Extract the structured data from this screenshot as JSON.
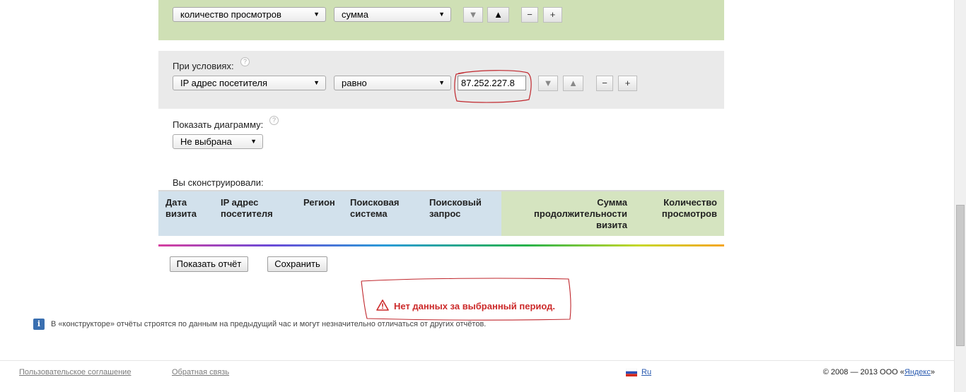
{
  "measure": {
    "metric_select": "количество просмотров",
    "aggregate_select": "сумма",
    "move_down": "▼",
    "move_up": "▲",
    "remove": "−",
    "add": "+"
  },
  "conditions": {
    "label": "При условиях:",
    "help": "?",
    "field_select": "IP адрес посетителя",
    "operator_select": "равно",
    "value": "87.252.227.8",
    "move_down": "▼",
    "move_up": "▲",
    "remove": "−",
    "add": "+"
  },
  "diagram": {
    "label": "Показать диаграмму:",
    "help": "?",
    "select": "Не выбрана"
  },
  "constructed": {
    "label": "Вы сконструировали:",
    "columns": [
      {
        "line1": "Дата",
        "line2": "визита",
        "line3": ""
      },
      {
        "line1": "IP адрес",
        "line2": "посетителя",
        "line3": ""
      },
      {
        "line1": "Регион",
        "line2": "",
        "line3": ""
      },
      {
        "line1": "Поисковая",
        "line2": "система",
        "line3": ""
      },
      {
        "line1": "Поисковый",
        "line2": "запрос",
        "line3": ""
      },
      {
        "line1": "Сумма",
        "line2": "продолжительности",
        "line3": "визита"
      },
      {
        "line1": "Количество",
        "line2": "просмотров",
        "line3": ""
      }
    ]
  },
  "actions": {
    "show_report": "Показать отчёт",
    "save": "Сохранить"
  },
  "error": {
    "message": "Нет данных за выбранный период."
  },
  "info": {
    "icon": "i",
    "text": "В «конструкторе» отчёты строятся по данным на предыдущий час и могут незначительно отличаться от других отчётов."
  },
  "footer": {
    "agreement": "Пользовательское соглашение",
    "feedback": "Обратная связь",
    "language": "Ru",
    "copyright_prefix": "© 2008 — 2013 ООО «",
    "company": "Яндекс",
    "copyright_suffix": "»"
  },
  "colors": {
    "measure_bg": "#cfe0b5",
    "conditions_bg": "#eaeaea",
    "dim_header_bg": "#d2e1ec",
    "metric_header_bg": "#d5e4c0",
    "error_red": "#cc2a2a",
    "annotation_red": "#c0272d"
  },
  "icons": {
    "select_arrow": "chevron-down-icon",
    "warning": "warning-icon",
    "info": "info-icon",
    "flag": "russia-flag-icon"
  }
}
